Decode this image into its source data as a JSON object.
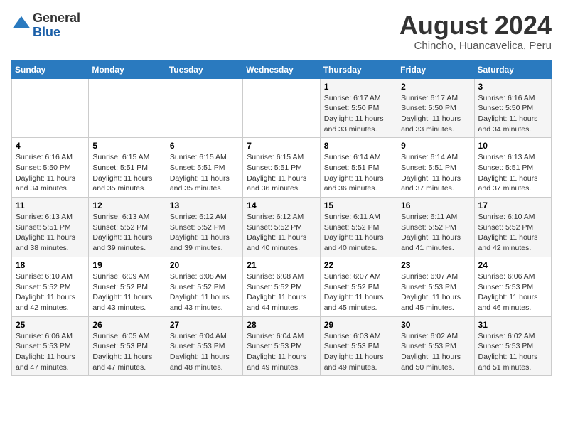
{
  "logo": {
    "general": "General",
    "blue": "Blue"
  },
  "header": {
    "month_year": "August 2024",
    "location": "Chincho, Huancavelica, Peru"
  },
  "weekdays": [
    "Sunday",
    "Monday",
    "Tuesday",
    "Wednesday",
    "Thursday",
    "Friday",
    "Saturday"
  ],
  "weeks": [
    [
      {
        "day": "",
        "info": ""
      },
      {
        "day": "",
        "info": ""
      },
      {
        "day": "",
        "info": ""
      },
      {
        "day": "",
        "info": ""
      },
      {
        "day": "1",
        "info": "Sunrise: 6:17 AM\nSunset: 5:50 PM\nDaylight: 11 hours\nand 33 minutes."
      },
      {
        "day": "2",
        "info": "Sunrise: 6:17 AM\nSunset: 5:50 PM\nDaylight: 11 hours\nand 33 minutes."
      },
      {
        "day": "3",
        "info": "Sunrise: 6:16 AM\nSunset: 5:50 PM\nDaylight: 11 hours\nand 34 minutes."
      }
    ],
    [
      {
        "day": "4",
        "info": "Sunrise: 6:16 AM\nSunset: 5:50 PM\nDaylight: 11 hours\nand 34 minutes."
      },
      {
        "day": "5",
        "info": "Sunrise: 6:15 AM\nSunset: 5:51 PM\nDaylight: 11 hours\nand 35 minutes."
      },
      {
        "day": "6",
        "info": "Sunrise: 6:15 AM\nSunset: 5:51 PM\nDaylight: 11 hours\nand 35 minutes."
      },
      {
        "day": "7",
        "info": "Sunrise: 6:15 AM\nSunset: 5:51 PM\nDaylight: 11 hours\nand 36 minutes."
      },
      {
        "day": "8",
        "info": "Sunrise: 6:14 AM\nSunset: 5:51 PM\nDaylight: 11 hours\nand 36 minutes."
      },
      {
        "day": "9",
        "info": "Sunrise: 6:14 AM\nSunset: 5:51 PM\nDaylight: 11 hours\nand 37 minutes."
      },
      {
        "day": "10",
        "info": "Sunrise: 6:13 AM\nSunset: 5:51 PM\nDaylight: 11 hours\nand 37 minutes."
      }
    ],
    [
      {
        "day": "11",
        "info": "Sunrise: 6:13 AM\nSunset: 5:51 PM\nDaylight: 11 hours\nand 38 minutes."
      },
      {
        "day": "12",
        "info": "Sunrise: 6:13 AM\nSunset: 5:52 PM\nDaylight: 11 hours\nand 39 minutes."
      },
      {
        "day": "13",
        "info": "Sunrise: 6:12 AM\nSunset: 5:52 PM\nDaylight: 11 hours\nand 39 minutes."
      },
      {
        "day": "14",
        "info": "Sunrise: 6:12 AM\nSunset: 5:52 PM\nDaylight: 11 hours\nand 40 minutes."
      },
      {
        "day": "15",
        "info": "Sunrise: 6:11 AM\nSunset: 5:52 PM\nDaylight: 11 hours\nand 40 minutes."
      },
      {
        "day": "16",
        "info": "Sunrise: 6:11 AM\nSunset: 5:52 PM\nDaylight: 11 hours\nand 41 minutes."
      },
      {
        "day": "17",
        "info": "Sunrise: 6:10 AM\nSunset: 5:52 PM\nDaylight: 11 hours\nand 42 minutes."
      }
    ],
    [
      {
        "day": "18",
        "info": "Sunrise: 6:10 AM\nSunset: 5:52 PM\nDaylight: 11 hours\nand 42 minutes."
      },
      {
        "day": "19",
        "info": "Sunrise: 6:09 AM\nSunset: 5:52 PM\nDaylight: 11 hours\nand 43 minutes."
      },
      {
        "day": "20",
        "info": "Sunrise: 6:08 AM\nSunset: 5:52 PM\nDaylight: 11 hours\nand 43 minutes."
      },
      {
        "day": "21",
        "info": "Sunrise: 6:08 AM\nSunset: 5:52 PM\nDaylight: 11 hours\nand 44 minutes."
      },
      {
        "day": "22",
        "info": "Sunrise: 6:07 AM\nSunset: 5:52 PM\nDaylight: 11 hours\nand 45 minutes."
      },
      {
        "day": "23",
        "info": "Sunrise: 6:07 AM\nSunset: 5:53 PM\nDaylight: 11 hours\nand 45 minutes."
      },
      {
        "day": "24",
        "info": "Sunrise: 6:06 AM\nSunset: 5:53 PM\nDaylight: 11 hours\nand 46 minutes."
      }
    ],
    [
      {
        "day": "25",
        "info": "Sunrise: 6:06 AM\nSunset: 5:53 PM\nDaylight: 11 hours\nand 47 minutes."
      },
      {
        "day": "26",
        "info": "Sunrise: 6:05 AM\nSunset: 5:53 PM\nDaylight: 11 hours\nand 47 minutes."
      },
      {
        "day": "27",
        "info": "Sunrise: 6:04 AM\nSunset: 5:53 PM\nDaylight: 11 hours\nand 48 minutes."
      },
      {
        "day": "28",
        "info": "Sunrise: 6:04 AM\nSunset: 5:53 PM\nDaylight: 11 hours\nand 49 minutes."
      },
      {
        "day": "29",
        "info": "Sunrise: 6:03 AM\nSunset: 5:53 PM\nDaylight: 11 hours\nand 49 minutes."
      },
      {
        "day": "30",
        "info": "Sunrise: 6:02 AM\nSunset: 5:53 PM\nDaylight: 11 hours\nand 50 minutes."
      },
      {
        "day": "31",
        "info": "Sunrise: 6:02 AM\nSunset: 5:53 PM\nDaylight: 11 hours\nand 51 minutes."
      }
    ]
  ]
}
